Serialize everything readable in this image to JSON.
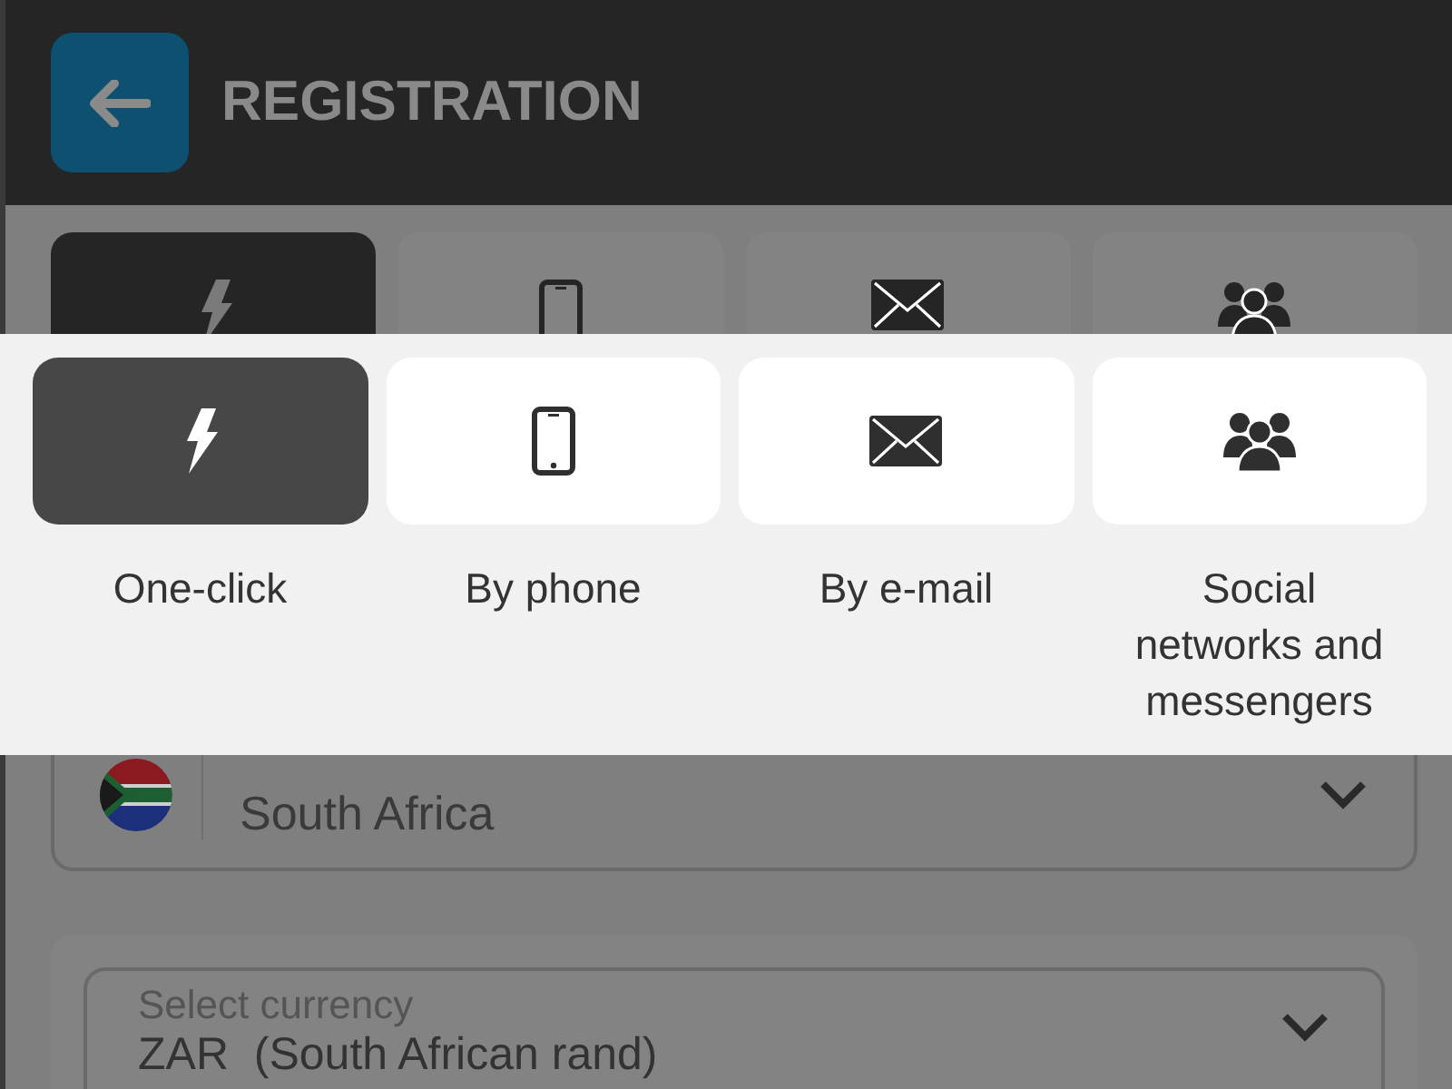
{
  "header": {
    "title": "REGISTRATION"
  },
  "background_tabs": [
    {
      "kind": "lightning",
      "selected": true
    },
    {
      "kind": "phone",
      "selected": false
    },
    {
      "kind": "mail",
      "selected": false
    },
    {
      "kind": "people",
      "selected": false
    }
  ],
  "country_field": {
    "value": "South Africa"
  },
  "currency_field": {
    "label": "Select currency",
    "value": "ZAR  (South African rand)"
  },
  "method_tabs": [
    {
      "kind": "lightning",
      "label": "One-click",
      "selected": true
    },
    {
      "kind": "phone",
      "label": "By phone",
      "selected": false
    },
    {
      "kind": "mail",
      "label": "By e-mail",
      "selected": false
    },
    {
      "kind": "people",
      "label": "Social networks and messengers",
      "selected": false
    }
  ]
}
